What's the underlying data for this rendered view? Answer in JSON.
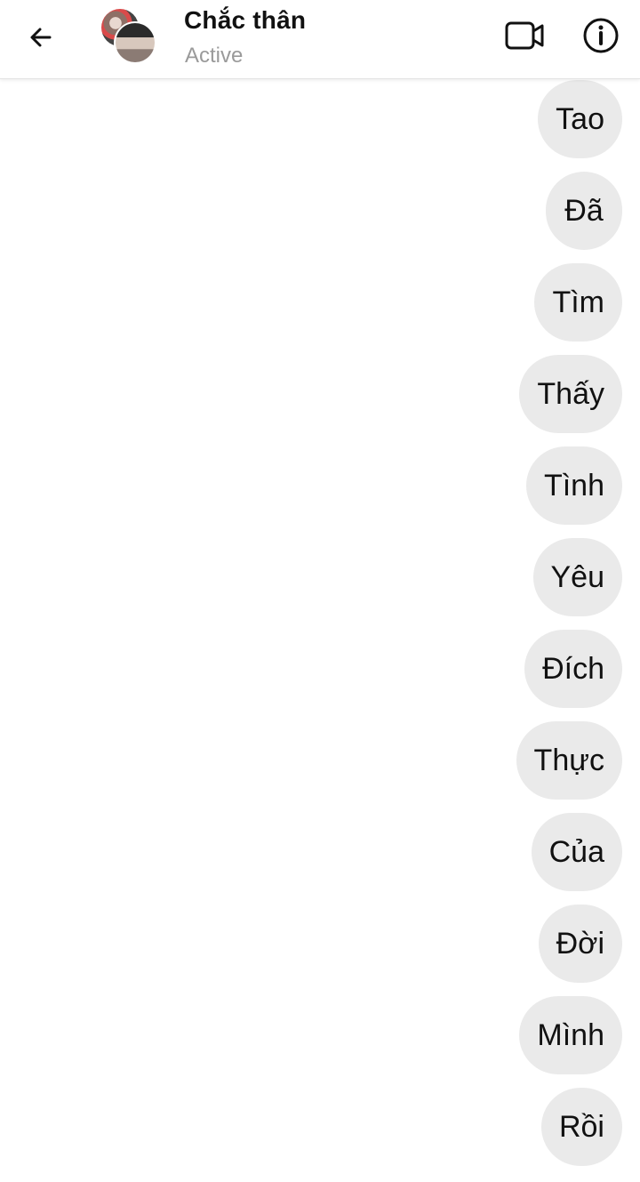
{
  "header": {
    "contact_name": "Chắc thân",
    "status": "Active",
    "icons": {
      "back": "arrow-left-icon",
      "video": "video-call-icon",
      "info": "info-icon"
    }
  },
  "messages": [
    "Tao",
    "Đã",
    "Tìm",
    "Thấy",
    "Tình",
    "Yêu",
    "Đích",
    "Thực",
    "Của",
    "Đời",
    "Mình",
    "Rồi"
  ],
  "colors": {
    "header_background": "#ffffff",
    "bubble_background": "#eaeaea",
    "status_text": "#9a9a9a"
  }
}
